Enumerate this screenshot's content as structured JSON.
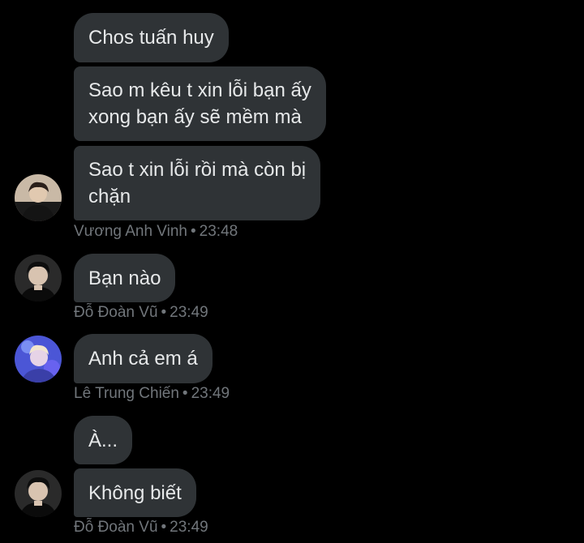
{
  "messages": [
    {
      "text": "Chos tuấn huy"
    },
    {
      "text_line1": "Sao m kêu t xin lỗi bạn ấy",
      "text_line2": "xong bạn ấy sẽ mềm mà"
    },
    {
      "text_line1": "Sao t xin lỗi rồi mà còn bị",
      "text_line2": "chặn"
    },
    {
      "text": "Bạn nào"
    },
    {
      "text": "Anh cả em á"
    },
    {
      "text": "À..."
    },
    {
      "text": "Không biết"
    }
  ],
  "meta": [
    {
      "sender": "Vương Anh Vinh",
      "separator": "•",
      "time": "23:48"
    },
    {
      "sender": "Đỗ Đoàn Vũ",
      "separator": "•",
      "time": "23:49"
    },
    {
      "sender": "Lê Trung Chiến",
      "separator": "•",
      "time": "23:49"
    },
    {
      "sender": "Đỗ Đoàn Vũ",
      "separator": "•",
      "time": "23:49"
    }
  ],
  "colors": {
    "background": "#000000",
    "bubble": "#2f3336",
    "bubble_text": "#e7e9ea",
    "meta_text": "#71767b"
  }
}
